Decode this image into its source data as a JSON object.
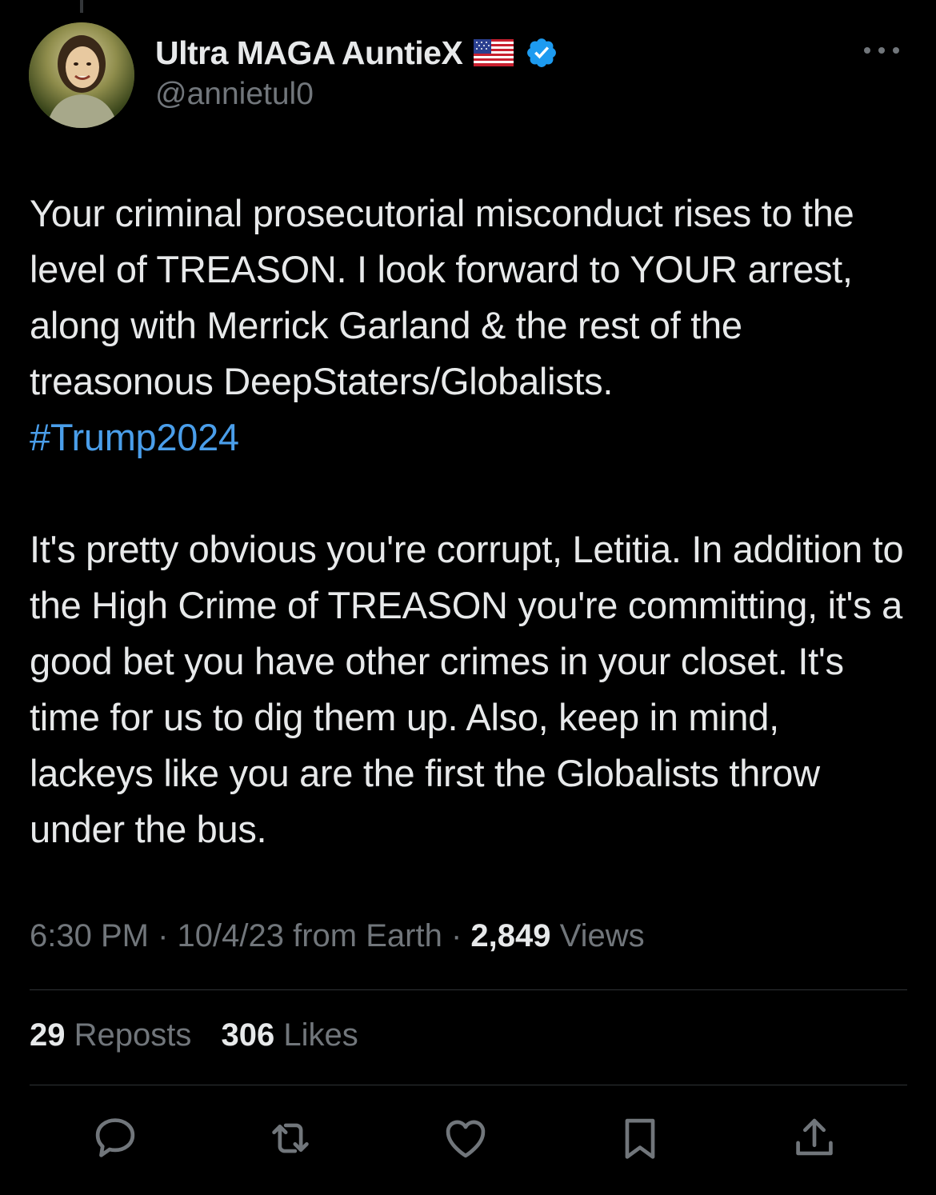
{
  "author": {
    "display_name": "Ultra MAGA AuntieX",
    "handle": "@annietul0",
    "flag_icon": "us-flag-icon",
    "verified_icon": "verified-badge-icon"
  },
  "tweet": {
    "paragraph1": "Your criminal prosecutorial misconduct rises to the level of TREASON. I look forward to YOUR arrest, along with Merrick Garland & the rest of the treasonous DeepStaters/Globalists.",
    "hashtag": "#Trump2024",
    "paragraph2": "It's pretty obvious you're corrupt, Letitia. In addition to the High Crime of TREASON you're committing, it's a good bet you have other crimes in your closet.  It's time for us to dig them up. Also, keep in mind, lackeys like you are the first the Globalists throw under the bus."
  },
  "meta": {
    "time": "6:30 PM",
    "separator": "·",
    "date_source": "10/4/23 from Earth",
    "views_count": "2,849",
    "views_label": "Views"
  },
  "stats": {
    "reposts_count": "29",
    "reposts_label": "Reposts",
    "likes_count": "306",
    "likes_label": "Likes"
  },
  "actions": [
    "reply-icon",
    "repost-icon",
    "like-icon",
    "bookmark-icon",
    "share-icon"
  ],
  "colors": {
    "background": "#000000",
    "text": "#e7e9ea",
    "secondary": "#71767b",
    "accent": "#4a9eea",
    "verified": "#1d9bf0",
    "divider": "#2f3336"
  }
}
